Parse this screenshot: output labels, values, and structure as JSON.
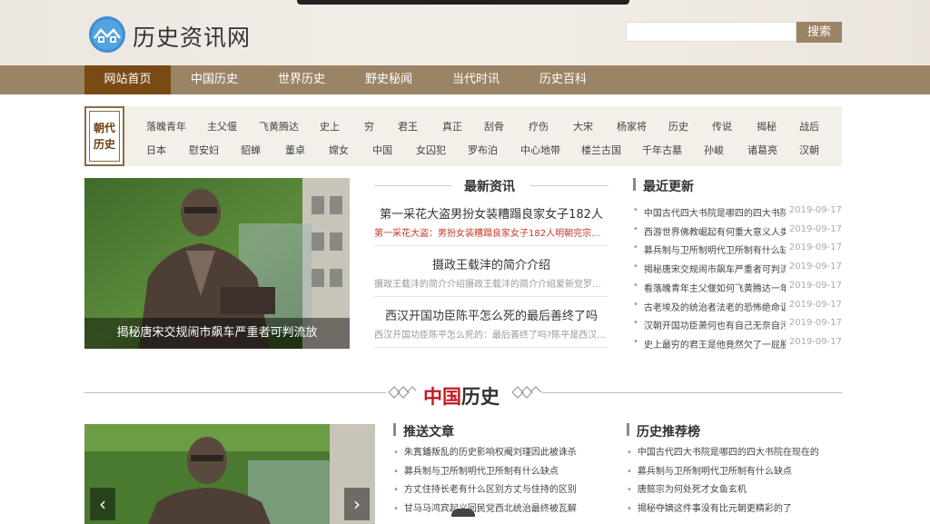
{
  "site": {
    "name": "历史资讯网"
  },
  "search": {
    "placeholder": "",
    "button_label": "搜索"
  },
  "nav": [
    "网站首页",
    "中国历史",
    "世界历史",
    "野史秘闻",
    "当代时讯",
    "历史百科"
  ],
  "tags": {
    "badge_line1": "朝代",
    "badge_line2": "历史",
    "row1": [
      "落魄青年",
      "主父偃",
      "飞黄腾达",
      "史上",
      "穷",
      "君王",
      "真正",
      "刮骨",
      "疗伤",
      "大宋",
      "杨家将",
      "历史",
      "传说",
      "揭秘",
      "战后"
    ],
    "row2": [
      "日本",
      "慰安妇",
      "貂蝉",
      "董卓",
      "嫦女",
      "中国",
      "女囚犯",
      "罗布泊",
      "中心地带",
      "楼兰古国",
      "千年古墓",
      "孙峻",
      "诸葛亮",
      "汉朝"
    ]
  },
  "featured": {
    "caption": "揭秘唐宋交规闹市飙车严重者可判流放"
  },
  "latest": {
    "heading": "最新资讯",
    "items": [
      {
        "title": "第一采花大盗男扮女装糟蹋良家女子182人",
        "summary": "第一采花大盗：男扮女装糟蹋良家女子182人明朝完宗..."
      },
      {
        "title": "摄政王载沣的简介介绍",
        "summary": "摄政王载沣的简介介绍摄政王载沣的简介介绍爱新觉罗..."
      },
      {
        "title": "西汉开国功臣陈平怎么死的最后善终了吗",
        "summary": "西汉开国功臣陈平怎么死的：最后善终了吗?陈平是西汉..."
      }
    ]
  },
  "recent": {
    "heading": "最近更新",
    "items": [
      {
        "title": "中国古代四大书院是哪四的四大书院",
        "date": "2019-09-17"
      },
      {
        "title": "西游世界佛教崛起有何重大意义人类",
        "date": "2019-09-17"
      },
      {
        "title": "募兵制与卫所制明代卫所制有什么缺",
        "date": "2019-09-17"
      },
      {
        "title": "揭秘唐宋交规闹市飙车严重者可判流",
        "date": "2019-09-17"
      },
      {
        "title": "看落魄青年主父偃如何飞黄腾达一年",
        "date": "2019-09-17"
      },
      {
        "title": "古老埃及的统治者法老的恐怖绝命诅",
        "date": "2019-09-17"
      },
      {
        "title": "汉朝开国功臣萧何也有自己无奈自污",
        "date": "2019-09-17"
      },
      {
        "title": "史上最穷的君王是他竟然欠了一屁股",
        "date": "2019-09-17"
      }
    ]
  },
  "section": {
    "title_red": "中国",
    "title_dark": "历史"
  },
  "recommended": {
    "heading": "推送文章",
    "items": [
      "朱寘鐇叛乱的历史影响权阉刘瑾因此被诛杀",
      "募兵制与卫所制明代卫所制有什么缺点",
      "方丈住持长老有什么区别方丈与住持的区别",
      "甘马马鸿宾起义回民党西北统治最终被瓦解"
    ]
  },
  "ranking": {
    "heading": "历史推荐榜",
    "items": [
      "中国古代四大书院是哪四的四大书院在现在的",
      "募兵制与卫所制明代卫所制有什么缺点",
      "唐懿宗为何处死才女鱼玄机",
      "揭秘夺嫡这件事没有比元朝更精彩的了"
    ]
  },
  "carousel": {
    "prev": "‹",
    "next": "›"
  },
  "colors": {
    "nav_bg": "#9b8466",
    "nav_active": "#7a4a14",
    "accent_red": "#c8161d"
  }
}
